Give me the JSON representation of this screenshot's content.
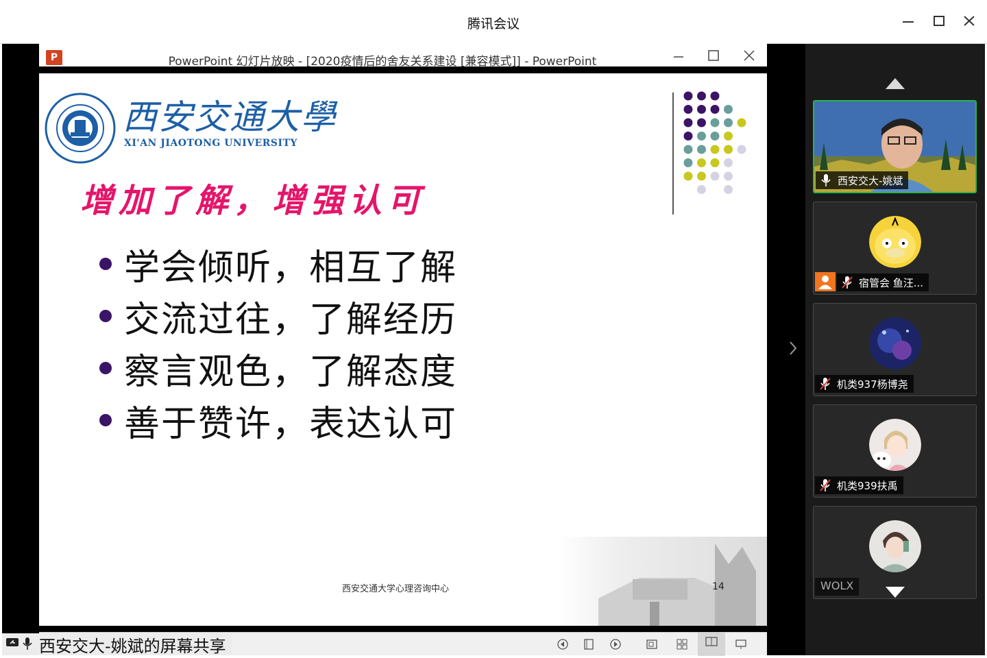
{
  "window": {
    "title": "腾讯会议"
  },
  "powerpoint": {
    "title": "PowerPoint 幻灯片放映 - [2020疫情后的舍友关系建设 [兼容模式]] - PowerPoint",
    "logo_letter": "P"
  },
  "slide": {
    "university_cn": "西安交通大學",
    "university_en": "XI'AN JIAOTONG UNIVERSITY",
    "headline": "增加了解，增强认可",
    "bullets": [
      "学会倾听，相互了解",
      "交流过往，了解经历",
      "察言观色，了解态度",
      "善于赞许，表达认可"
    ],
    "footer": "西安交通大学心理咨询中心",
    "page_number": "14",
    "colors": {
      "headline": "#e5156a",
      "bullet_dot": "#3a1466",
      "university": "#1d5fa6",
      "dot_purple": "#3d1367",
      "dot_teal": "#6a9e9b",
      "dot_yellow": "#c8c81e",
      "dot_lavender": "#d5d2e3"
    }
  },
  "share": {
    "label": "西安交大-姚斌的屏幕共享"
  },
  "participants": [
    {
      "name": "西安交大-姚斌",
      "state": "speaking",
      "mic": "on",
      "video": true
    },
    {
      "name": "宿管会 鱼汪...",
      "state": "host",
      "mic": "muted",
      "video": false
    },
    {
      "name": "机类937杨博尧",
      "mic": "muted",
      "video": false
    },
    {
      "name": "机类939扶禹",
      "mic": "muted",
      "video": false
    },
    {
      "name": "WOLX",
      "video": false
    }
  ],
  "accent_color": "#2bb34a"
}
